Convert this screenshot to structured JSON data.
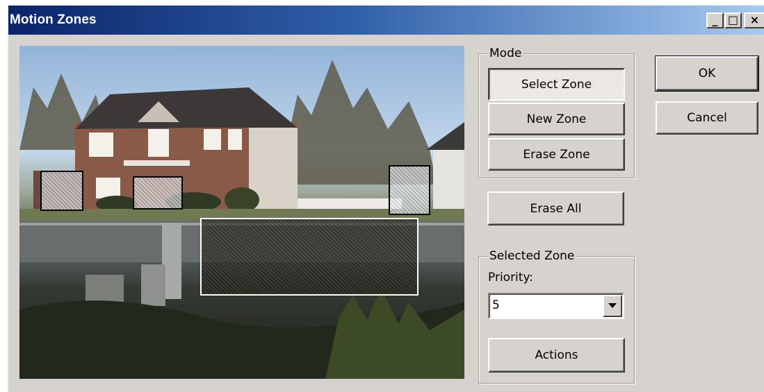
{
  "window": {
    "title": "Motion Zones",
    "minimize_glyph": "_",
    "maximize_glyph": "□",
    "close_glyph": "×"
  },
  "mode": {
    "legend": "Mode",
    "select_zone": "Select Zone",
    "new_zone": "New Zone",
    "erase_zone": "Erase Zone",
    "active": "select_zone"
  },
  "erase_all": "Erase All",
  "selected_zone": {
    "legend": "Selected Zone",
    "priority_label": "Priority:",
    "priority_value": "5",
    "actions": "Actions"
  },
  "ok": "OK",
  "cancel": "Cancel",
  "icons": {
    "dropdown": "chevron-down-icon"
  },
  "colors": {
    "titlebar_start": "#0a246a",
    "titlebar_end": "#a6caf0",
    "dialog_face": "#d6d3ce",
    "selected_zone_border": "#ffffff",
    "zone_border": "#000000"
  }
}
